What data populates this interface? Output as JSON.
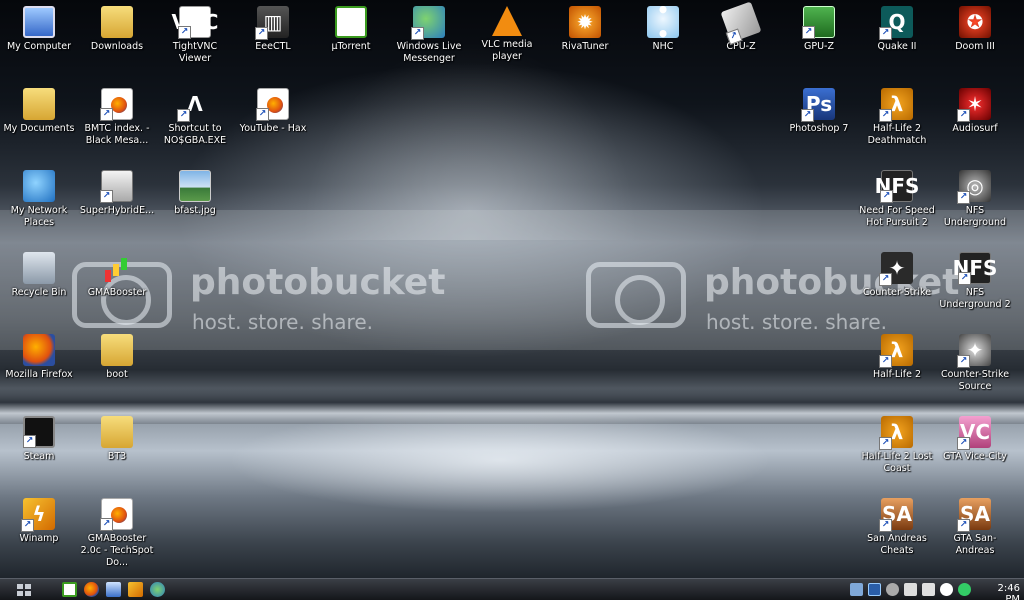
{
  "watermark": {
    "brand": "photobucket",
    "tagline": "host. store. share."
  },
  "desktop_icons": [
    {
      "name": "my-computer",
      "label": "My Computer",
      "icon": "computer-icon"
    },
    {
      "name": "downloads",
      "label": "Downloads",
      "icon": "folder-icon"
    },
    {
      "name": "tightvnc-viewer",
      "label": "TightVNC Viewer",
      "icon": "vnc-icon"
    },
    {
      "name": "esectl",
      "label": "EeeCTL",
      "icon": "chip-icon"
    },
    {
      "name": "utorrent",
      "label": "µTorrent",
      "icon": "utorrent-icon"
    },
    {
      "name": "windows-live-messenger",
      "label": "Windows Live Messenger",
      "icon": "messenger-icon"
    },
    {
      "name": "vlc-media-player",
      "label": "VLC media player",
      "icon": "vlc-cone-icon"
    },
    {
      "name": "rivatuner",
      "label": "RivaTuner",
      "icon": "gear-icon"
    },
    {
      "name": "nhc",
      "label": "NHC",
      "icon": "ghost-icon"
    },
    {
      "name": "cpu-z",
      "label": "CPU-Z",
      "icon": "cpu-icon"
    },
    {
      "name": "gpu-z",
      "label": "GPU-Z",
      "icon": "graphics-card-icon"
    },
    {
      "name": "quake-ii",
      "label": "Quake II",
      "icon": "quake-icon"
    },
    {
      "name": "doom-iii",
      "label": "Doom III",
      "icon": "pentagram-icon"
    },
    {
      "name": "my-documents",
      "label": "My Documents",
      "icon": "folder-icon"
    },
    {
      "name": "bmtc-index",
      "label": "BMTC index. - Black Mesa...",
      "icon": "firefox-document-icon"
    },
    {
      "name": "shortcut-nosgba",
      "label": "Shortcut to NO$GBA.EXE",
      "icon": "arch-icon"
    },
    {
      "name": "youtube-hax",
      "label": "YouTube - Hax",
      "icon": "firefox-document-icon"
    },
    {
      "name": "photoshop-7",
      "label": "Photoshop 7",
      "icon": "photoshop-icon"
    },
    {
      "name": "half-life-2-deathmatch",
      "label": "Half-Life 2 Deathmatch",
      "icon": "half-life-icon"
    },
    {
      "name": "audiosurf",
      "label": "Audiosurf",
      "icon": "audiosurf-icon"
    },
    {
      "name": "my-network-places",
      "label": "My Network Places",
      "icon": "network-globe-icon"
    },
    {
      "name": "superhybridengine",
      "label": "SuperHybridE...",
      "icon": "hybrid-engine-icon"
    },
    {
      "name": "bfast-jpg",
      "label": "bfast.jpg",
      "icon": "image-file-icon"
    },
    {
      "name": "need-for-speed-hot-pursuit-2",
      "label": "Need For Speed Hot Pursuit 2",
      "icon": "nfs-icon"
    },
    {
      "name": "nfs-underground",
      "label": "NFS Underground",
      "icon": "nfs-wheel-icon"
    },
    {
      "name": "recycle-bin",
      "label": "Recycle Bin",
      "icon": "recycle-bin-icon"
    },
    {
      "name": "gmabooster",
      "label": "GMABooster",
      "icon": "bar-graph-icon"
    },
    {
      "name": "counter-strike",
      "label": "Counter-Strike",
      "icon": "counter-strike-icon"
    },
    {
      "name": "nfs-underground-2",
      "label": "NFS Underground 2",
      "icon": "nfs-icon"
    },
    {
      "name": "mozilla-firefox",
      "label": "Mozilla Firefox",
      "icon": "firefox-icon"
    },
    {
      "name": "boot",
      "label": "boot",
      "icon": "folder-icon"
    },
    {
      "name": "half-life-2",
      "label": "Half-Life 2",
      "icon": "half-life-icon"
    },
    {
      "name": "counter-strike-source",
      "label": "Counter-Strike Source",
      "icon": "counter-strike-source-icon"
    },
    {
      "name": "steam",
      "label": "Steam",
      "icon": "steam-icon"
    },
    {
      "name": "bt3",
      "label": "BT3",
      "icon": "folder-icon"
    },
    {
      "name": "half-life-2-lost-coast",
      "label": "Half-Life 2 Lost Coast",
      "icon": "half-life-icon"
    },
    {
      "name": "gta-vice-city",
      "label": "GTA Vice-City",
      "icon": "gta-vice-city-icon"
    },
    {
      "name": "winamp",
      "label": "Winamp",
      "icon": "winamp-icon"
    },
    {
      "name": "gmabooster-2-techspot",
      "label": "GMABooster 2.0c - TechSpot Do...",
      "icon": "firefox-document-icon"
    },
    {
      "name": "san-andreas-cheats",
      "label": "San Andreas Cheats",
      "icon": "gta-san-andreas-icon"
    },
    {
      "name": "gta-san-andreas",
      "label": "GTA San-Andreas",
      "icon": "gta-san-andreas-icon"
    }
  ],
  "taskbar": {
    "start_icon": "windows-grid-icon",
    "quick_launch": [
      {
        "name": "utorrent",
        "icon": "utorrent-icon"
      },
      {
        "name": "firefox",
        "icon": "firefox-icon"
      },
      {
        "name": "vnc",
        "icon": "vnc-icon"
      },
      {
        "name": "winamp",
        "icon": "winamp-icon"
      },
      {
        "name": "messenger",
        "icon": "messenger-icon"
      }
    ],
    "tray_icons": [
      "network-icon",
      "cpu-temp-icon",
      "volume-icon",
      "power-icon",
      "battery-icon",
      "download-icon",
      "update-icon",
      "safe-remove-icon"
    ],
    "clock": "2:46 PM"
  },
  "colors": {
    "taskbar_top": "#3b3f46",
    "taskbar_bottom": "#14161a",
    "label_text": "#ffffff"
  }
}
